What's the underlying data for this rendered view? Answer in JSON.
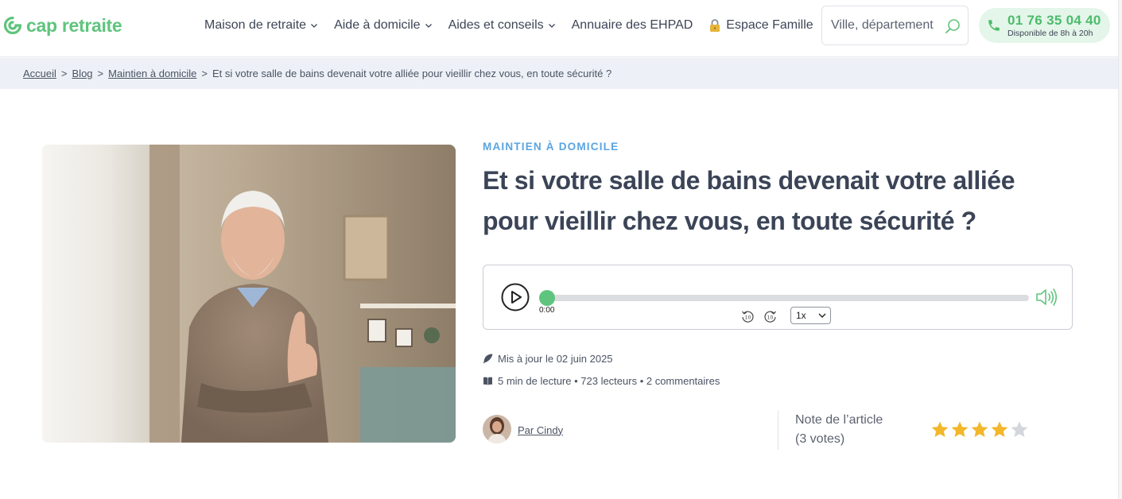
{
  "header": {
    "logo_text": "cap retraite",
    "nav": [
      {
        "label": "Maison de retraite",
        "has_dropdown": true
      },
      {
        "label": "Aide à domicile",
        "has_dropdown": true
      },
      {
        "label": "Aides et conseils",
        "has_dropdown": true
      },
      {
        "label": "Annuaire des EHPAD",
        "has_dropdown": false
      },
      {
        "label": "Espace Famille",
        "icon": "lock-icon"
      }
    ],
    "search": {
      "placeholder": "Ville, département",
      "icon": "search-icon"
    },
    "phone": {
      "number": "01 76 35 04 40",
      "hours": "Disponible de 8h à 20h",
      "icon": "phone-icon"
    }
  },
  "breadcrumb": {
    "items": [
      "Accueil",
      "Blog",
      "Maintien à domicile"
    ],
    "current": "Et si votre salle de bains devenait votre alliée pour vieillir chez vous, en toute sécurité ?",
    "separator": ">"
  },
  "article": {
    "category": "MAINTIEN À DOMICILE",
    "title": "Et si votre salle de bains devenait votre alliée pour vieillir chez vous, en toute sécurité ?",
    "updated": "Mis à jour le 02 juin 2025",
    "reading": "5 min de lecture • 723 lecteurs • 2 commentaires",
    "author": "Par Cindy",
    "rating": {
      "label_line1": "Note de l’article",
      "label_line2": "(3 votes)",
      "stars_filled": 4,
      "stars_total": 5
    }
  },
  "player": {
    "time": "0:00",
    "speed": "1x",
    "progress": 0
  },
  "colors": {
    "brand_green": "#5fc47d",
    "category_blue": "#5aa4e0",
    "title": "#3b4457",
    "star_filled": "#f2b72b",
    "star_empty": "#d3d6dc"
  }
}
